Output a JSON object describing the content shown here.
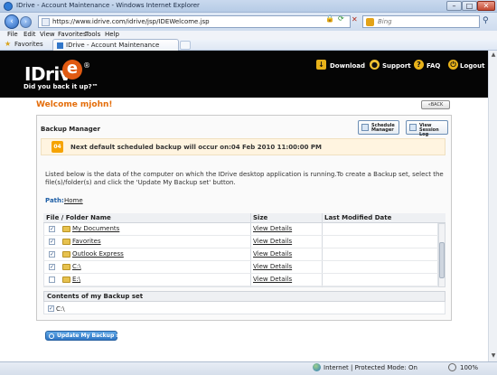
{
  "window": {
    "title": "IDrive - Account Maintenance - Windows Internet Explorer",
    "min_label": "–",
    "max_label": "□",
    "close_label": "✕"
  },
  "address": {
    "url": "https://www.idrive.com/idrive/jsp/IDEWelcome.jsp",
    "search_placeholder": "Bing"
  },
  "menu": [
    "File",
    "Edit",
    "View",
    "Favorites",
    "Tools",
    "Help"
  ],
  "favorites": {
    "label": "Favorites",
    "tab_title": "IDrive - Account Maintenance"
  },
  "header": {
    "logo_main": "IDriv",
    "logo_e": "e",
    "logo_reg": "®",
    "tagline": "Did you back it up?™",
    "links": {
      "download": "Download",
      "support": "Support",
      "faq": "FAQ",
      "logout": "Logout"
    }
  },
  "page": {
    "welcome": "Welcome mjohn!",
    "back_label": "«BACK",
    "panel_title": "Backup Manager",
    "schedule_btn": "Schedule\nManager",
    "session_btn": "View\nSession Log",
    "calendar_day": "04",
    "notice": "Next default scheduled backup will occur on:04 Feb 2010 11:00:00 PM",
    "info": "Listed below is the data of the computer on which the IDrive desktop application is running.To create a Backup set, select the file(s)/folder(s) and click the 'Update My Backup set' button.",
    "path_label": "Path:",
    "path_value": "Home"
  },
  "table": {
    "headers": [
      "File / Folder Name",
      "Size",
      "Last Modified Date"
    ],
    "rows": [
      {
        "name": "My Documents",
        "size": "View Details",
        "modified": "",
        "checked": true
      },
      {
        "name": "Favorites",
        "size": "View Details",
        "modified": "",
        "checked": true
      },
      {
        "name": "Outlook Express",
        "size": "View Details",
        "modified": "",
        "checked": true
      },
      {
        "name": "C:\\",
        "size": "View Details",
        "modified": "",
        "checked": true
      },
      {
        "name": "E:\\",
        "size": "View Details",
        "modified": "",
        "checked": false
      }
    ]
  },
  "backup_set": {
    "title": "Contents of my Backup set",
    "items": [
      "C:\\"
    ]
  },
  "update_button": "Update My Backup set",
  "status": {
    "zone": "Internet | Protected Mode: On",
    "zoom": "100%"
  },
  "colors": {
    "accent_orange": "#e46d0a",
    "header_black": "#050505",
    "button_blue": "#2f76c4"
  }
}
